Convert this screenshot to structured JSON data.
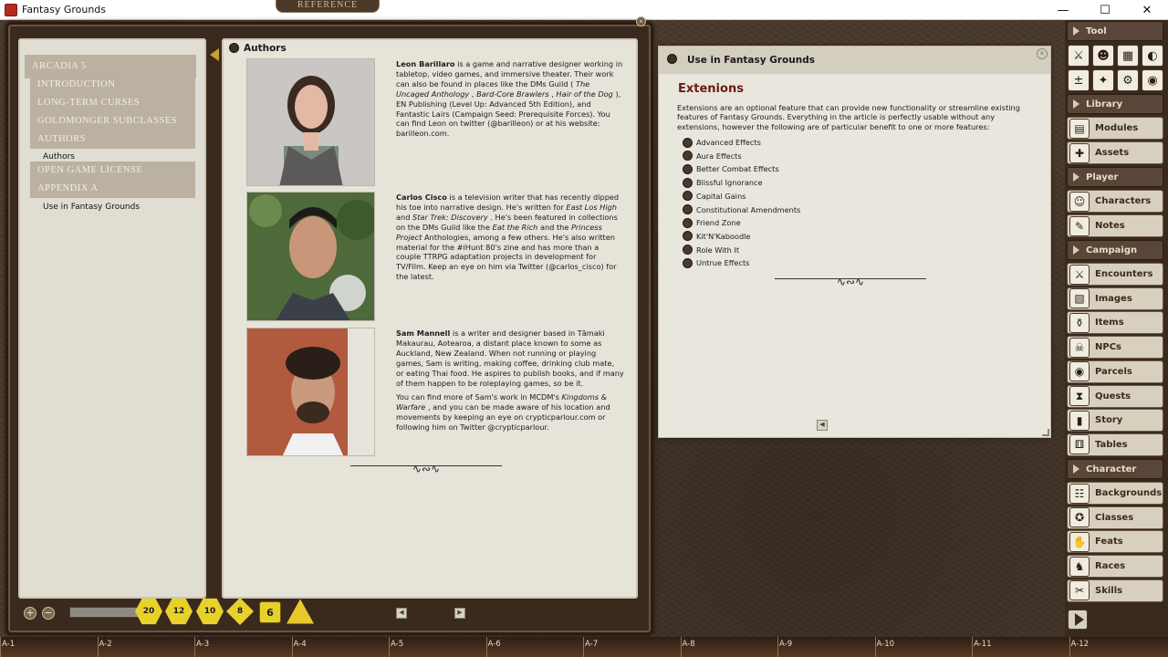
{
  "window": {
    "title": "Fantasy Grounds"
  },
  "library": {
    "header_tab": "REFERENCE",
    "toc": [
      {
        "label": "ARCADIA 5"
      },
      {
        "label": "INTRODUCTION"
      },
      {
        "label": "LONG-TERM CURSES"
      },
      {
        "label": "GOLDMONGER SUBCLASSES"
      },
      {
        "label": "AUTHORS"
      },
      {
        "label": "OPEN GAME LICENSE"
      },
      {
        "label": "APPENDIX A"
      }
    ],
    "toc_sub": [
      "Authors",
      "Use in Fantasy Grounds"
    ],
    "content_title": "Authors",
    "authors": [
      {
        "name": "Leon Barillaro",
        "bio": [
          {
            "t": " is a game and narrative designer working in tabletop, video games, and immersive theater. Their work can also be found in places like the DMs Guild ( "
          },
          {
            "i": "The Uncaged Anthology"
          },
          {
            "t": " , "
          },
          {
            "i": "Bard-Core Brawlers"
          },
          {
            "t": " , "
          },
          {
            "i": "Hair of the Dog"
          },
          {
            "t": " ), EN Publishing (Level Up: Advanced 5th Edition), and Fantastic Lairs (Campaign Seed: Prerequisite Forces). You can find Leon on twitter (@barilleon) or at his website: barilleon.com."
          }
        ]
      },
      {
        "name": "Carlos Cisco",
        "bio": [
          {
            "t": " is a television writer that has recently dipped his toe into narrative design. He's written for "
          },
          {
            "i": "East Los High"
          },
          {
            "t": " and "
          },
          {
            "i": "Star Trek: Discovery"
          },
          {
            "t": " . He's been featured in collections on the DMs Guild like the "
          },
          {
            "i": "Eat the Rich"
          },
          {
            "t": " and the "
          },
          {
            "i": "Princess Project"
          },
          {
            "t": " Anthologies, among a few others. He's also written material for the #iHunt 80's zine and has more than a couple TTRPG adaptation projects in development for TV/Film. Keep an eye on him via Twitter (@carlos_cisco) for the latest."
          }
        ]
      },
      {
        "name": "Sam Mannell",
        "bio": [
          {
            "t": " is a writer and designer based in Tāmaki Makaurau, Aotearoa, a distant place known to some as Auckland, New Zealand. When not running or playing games, Sam is writing, making coffee, drinking club mate, or eating Thai food. He aspires to publish books, and if many of them happen to be roleplaying games, so be it."
          }
        ],
        "bio2": [
          {
            "t": "You can find more of Sam's work in MCDM's "
          },
          {
            "i": "Kingdoms & Warfare"
          },
          {
            "t": " , and you can be made aware of his location and movements by keeping an eye on crypticparlour.com or following him on Twitter @crypticparlour."
          }
        ]
      }
    ],
    "dice": [
      "20",
      "12",
      "10",
      "8",
      "6",
      ""
    ]
  },
  "use_window": {
    "title": "Use in Fantasy Grounds",
    "heading": "Extenions",
    "intro": "Extensions are an optional feature that can provide new functionality or streamline existing features of Fantasy Grounds. Everything in the article is perfectly usable without any extensions, however the following are of particular benefit to one or more features:",
    "extensions": [
      "Advanced Effects",
      "Aura Effects",
      "Better Combat Effects",
      "Blissful Ignorance",
      "Capital Gains",
      "Constitutional Amendments",
      "Friend Zone",
      "Kit'N'Kaboodle",
      "Role With It",
      "Untrue Effects"
    ]
  },
  "sidebar": {
    "tool_label": "Tool",
    "library_label": "Library",
    "library_items": [
      "Modules",
      "Assets"
    ],
    "player_label": "Player",
    "player_items": [
      "Characters",
      "Notes"
    ],
    "campaign_label": "Campaign",
    "campaign_items": [
      "Encounters",
      "Images",
      "Items",
      "NPCs",
      "Parcels",
      "Quests",
      "Story",
      "Tables"
    ],
    "character_label": "Character",
    "character_items": [
      "Backgrounds",
      "Classes",
      "Feats",
      "Races",
      "Skills"
    ]
  },
  "hotkeys": [
    "A-1",
    "A-2",
    "A-3",
    "A-4",
    "A-5",
    "A-6",
    "A-7",
    "A-8",
    "A-9",
    "A-10",
    "A-11",
    "A-12"
  ],
  "colors": {
    "heading_red": "#6e1a12",
    "panel_bg": "#e6e3d9",
    "leather": "#4a3a2e",
    "dice_yellow": "#e8d22a"
  }
}
